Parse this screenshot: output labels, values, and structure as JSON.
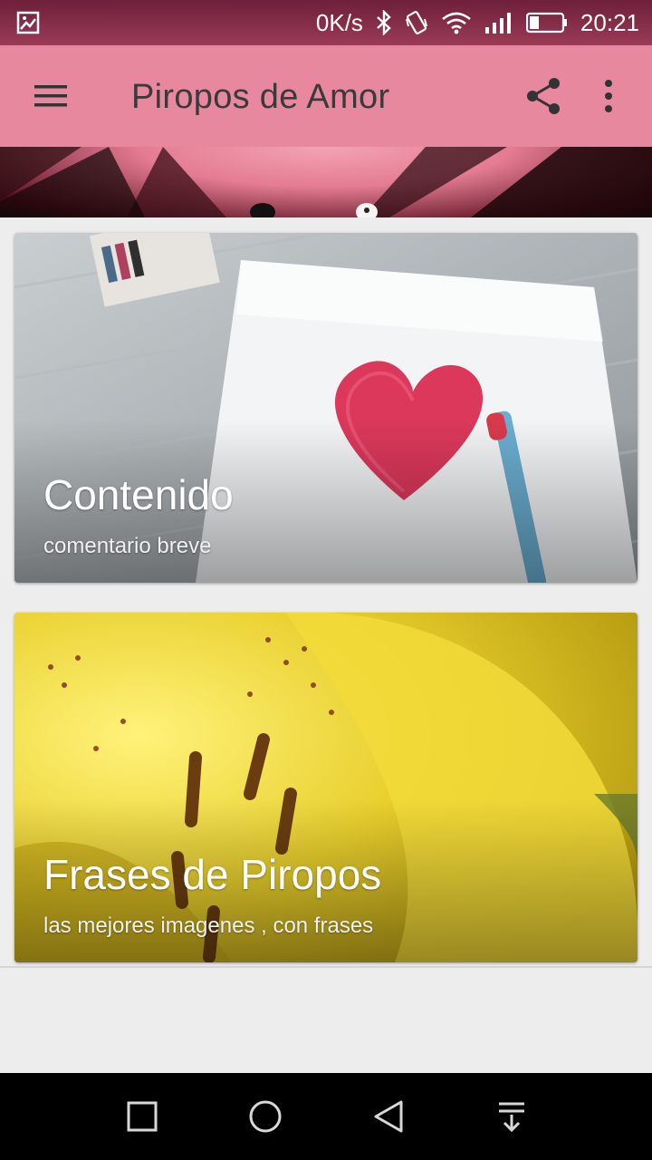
{
  "status_bar": {
    "speed": "0K/s",
    "time": "20:21",
    "icons": [
      "image-notification-icon",
      "bluetooth-icon",
      "vibrate-icon",
      "wifi-icon",
      "signal-icon",
      "battery-icon"
    ]
  },
  "app_bar": {
    "title": "Piropos de Amor",
    "background_color": "#e8889f",
    "icons": [
      "menu-icon",
      "share-icon",
      "more-vert-icon"
    ]
  },
  "cards": [
    {
      "title": "Contenido",
      "subtitle": "comentario  breve"
    },
    {
      "title": "Frases de Piropos",
      "subtitle": "las mejores imagenes , con frases"
    }
  ],
  "nav_bar": {
    "icons": [
      "recents-square-icon",
      "home-circle-icon",
      "back-triangle-icon",
      "notification-pull-icon"
    ]
  }
}
